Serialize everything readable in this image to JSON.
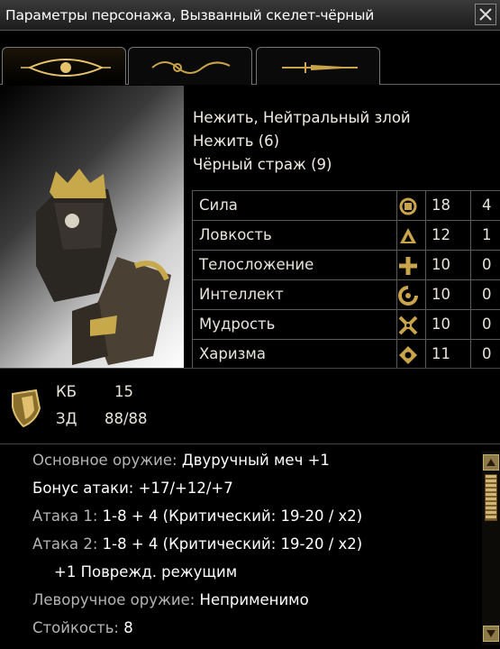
{
  "window": {
    "title": "Параметры персонажа, Вызванный скелет-чёрный"
  },
  "tabs": [
    {
      "icon": "eye-icon",
      "active": true
    },
    {
      "icon": "ornament-icon",
      "active": false
    },
    {
      "icon": "dagger-icon",
      "active": false
    }
  ],
  "info": {
    "race_alignment": "Нежить, Нейтральный злой",
    "class_level": "Нежить (6)",
    "second_class": "Чёрный страж (9)"
  },
  "stats": [
    {
      "name": "Сила",
      "icon": "strength-icon",
      "score": "18",
      "mod": "4"
    },
    {
      "name": "Ловкость",
      "icon": "dexterity-icon",
      "score": "12",
      "mod": "1"
    },
    {
      "name": "Телосложение",
      "icon": "constitution-icon",
      "score": "10",
      "mod": "0"
    },
    {
      "name": "Интеллект",
      "icon": "intelligence-icon",
      "score": "10",
      "mod": "0"
    },
    {
      "name": "Мудрость",
      "icon": "wisdom-icon",
      "score": "10",
      "mod": "0"
    },
    {
      "name": "Харизма",
      "icon": "charisma-icon",
      "score": "11",
      "mod": "0"
    }
  ],
  "defense": {
    "ac_label": "КБ",
    "ac_value": "15",
    "hp_label": "ЗД",
    "hp_value": "88/88"
  },
  "details": {
    "main_weapon_label": "Основное оружие:",
    "main_weapon_value": "Двуручный меч +1",
    "attack_bonus_label": "Бонус атаки:",
    "attack_bonus_value": "+17/+12/+7",
    "attack1_label": "Атака 1:",
    "attack1_value": "1-8 + 4 (Критический:  19-20 / x2)",
    "attack2_label": "Атака 2:",
    "attack2_value": "1-8 + 4 (Критический:  19-20 / x2)",
    "damage_bonus": "+1 Поврежд. режущим",
    "offhand_label": "Леворучное оружие:",
    "offhand_value": "Неприменимо",
    "fortitude_label": "Стойкость:",
    "fortitude_value": "8"
  },
  "colors": {
    "gold": "#c9a44a",
    "text": "#e8e4da",
    "label": "#b4b4b4",
    "background": "#000000"
  }
}
